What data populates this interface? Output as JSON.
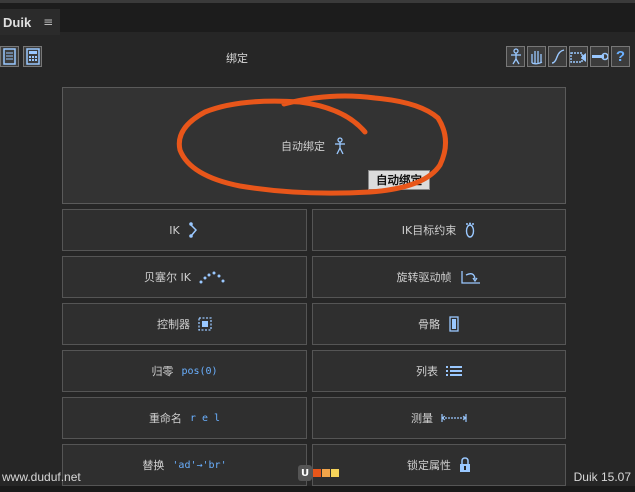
{
  "window": {
    "panel_title": "Duik",
    "menu_glyph": "≡"
  },
  "toolbar": {
    "left_icons": [
      "document-icon",
      "calculator-icon"
    ],
    "right_icons": [
      "human-figure-icon",
      "hand-icon",
      "curve-icon",
      "camera-icon",
      "wrench-icon",
      "help-icon"
    ],
    "help_label": "?"
  },
  "section": {
    "title": "绑定"
  },
  "auto_rig": {
    "label": "自动绑定",
    "icon": "human-figure-icon",
    "tooltip": "自动绑定"
  },
  "buttons": [
    {
      "label": "IK",
      "icon": "ik-chain-icon"
    },
    {
      "label": "IK目标约束",
      "icon": "foot-icon"
    },
    {
      "label": "贝塞尔 IK",
      "icon": "bezier-dots-icon"
    },
    {
      "label": "旋转驱动帧",
      "icon": "rotation-icon"
    },
    {
      "label": "控制器",
      "icon": "controller-icon"
    },
    {
      "label": "骨骼",
      "icon": "bone-icon"
    },
    {
      "label": "归零",
      "icon_text": "pos(0)"
    },
    {
      "label": "列表",
      "icon": "list-icon"
    },
    {
      "label": "重命名",
      "icon_text": "r e l"
    },
    {
      "label": "测量",
      "icon": "measure-icon"
    },
    {
      "label": "替换",
      "icon_text": "'ad'→'br'"
    },
    {
      "label": "锁定属性",
      "icon": "lock-icon"
    }
  ],
  "footer": {
    "left_text": "www.duduf.net",
    "right_text": "Duik 15.07"
  },
  "colors": {
    "accent": "#6ab0ff",
    "annotation": "#e8561a",
    "background": "#262626"
  }
}
